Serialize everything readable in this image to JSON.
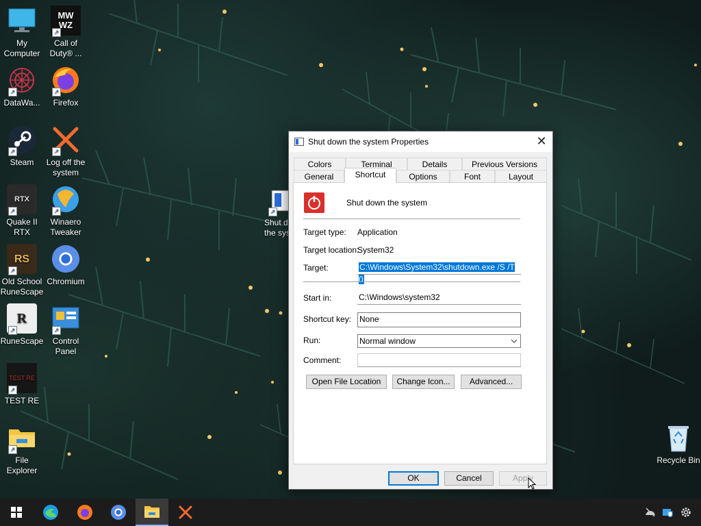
{
  "desktop": {
    "icons": [
      {
        "label": "My\nComputer",
        "icon": "monitor-icon"
      },
      {
        "label": "Call of\nDuty® ...",
        "icon": "cod-warzone-icon"
      },
      {
        "label": "DataWa...",
        "icon": "datawarp-icon"
      },
      {
        "label": "Firefox",
        "icon": "firefox-icon"
      },
      {
        "label": "Steam",
        "icon": "steam-icon"
      },
      {
        "label": "Log off the\nsystem",
        "icon": "red-x-icon"
      },
      {
        "label": "Quake II\nRTX",
        "icon": "quake-icon"
      },
      {
        "label": "Winaero\nTweaker",
        "icon": "winaero-icon"
      },
      {
        "label": "Old School\nRuneScape",
        "icon": "osrs-icon"
      },
      {
        "label": "Chromium",
        "icon": "chromium-icon"
      },
      {
        "label": "RuneScape",
        "icon": "runescape-icon"
      },
      {
        "label": "Control\nPanel",
        "icon": "control-panel-icon"
      },
      {
        "label": "TEST RE",
        "icon": "test-re-icon"
      },
      {
        "label": "File\nExplorer",
        "icon": "folder-icon"
      },
      {
        "label": "Shut d\nthe sys",
        "icon": "shortcut-window-icon"
      },
      {
        "label": "Recycle Bin",
        "icon": "recycle-bin-icon"
      }
    ]
  },
  "dialog": {
    "title": "Shut down the system Properties",
    "tabs_row1": [
      "Colors",
      "Terminal",
      "Details",
      "Previous Versions"
    ],
    "tabs_row2": [
      "General",
      "Shortcut",
      "Options",
      "Font",
      "Layout"
    ],
    "selected_tab": "Shortcut",
    "shortcut_name": "Shut down the system",
    "target_type_label": "Target type:",
    "target_type_value": "Application",
    "target_location_label": "Target location:",
    "target_location_value": "System32",
    "target_label": "Target:",
    "target_value": "C:\\Windows\\System32\\shutdown.exe /S /T 0",
    "start_in_label": "Start in:",
    "start_in_value": "C:\\Windows\\system32",
    "shortcut_key_label": "Shortcut key:",
    "shortcut_key_value": "None",
    "run_label": "Run:",
    "run_value": "Normal window",
    "comment_label": "Comment:",
    "comment_value": "",
    "open_file_location": "Open File Location",
    "change_icon": "Change Icon...",
    "advanced": "Advanced...",
    "ok": "OK",
    "cancel": "Cancel",
    "apply": "Apply"
  },
  "taskbar": {
    "items": [
      "start-icon",
      "edge-icon",
      "firefox-icon",
      "chromium-icon",
      "file-explorer-icon",
      "red-x-icon"
    ],
    "tray": [
      "network-off-icon",
      "security-icon",
      "settings-gear-icon"
    ]
  },
  "colors": {
    "accent": "#0078d7",
    "taskbar": "#1c1c1c",
    "power_red": "#d9302c"
  }
}
